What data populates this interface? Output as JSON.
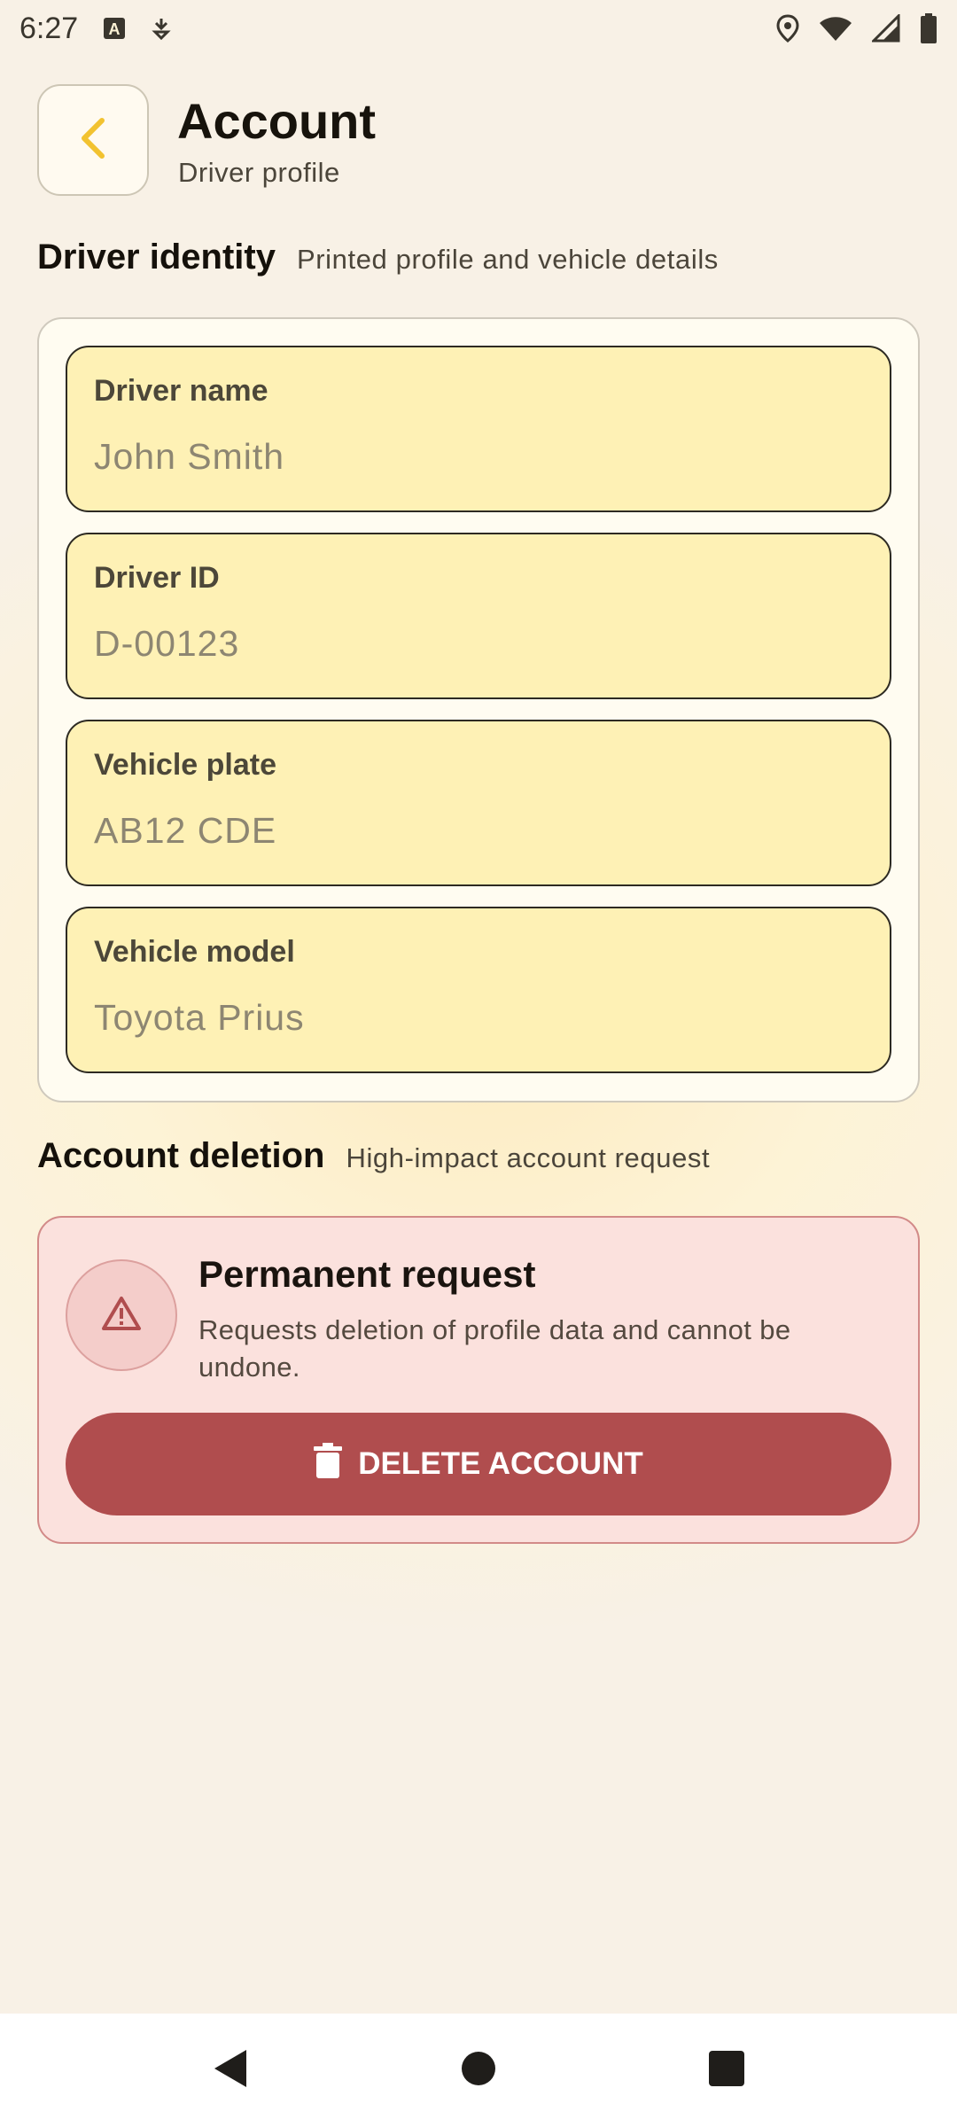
{
  "status_bar": {
    "time": "6:27",
    "icons_left": [
      "keyboard-a-icon",
      "download-arrow-icon"
    ],
    "icons_right": [
      "location-icon",
      "wifi-icon",
      "signal-icon",
      "battery-icon"
    ]
  },
  "header": {
    "back_icon": "chevron-left-icon",
    "title": "Account",
    "subtitle": "Driver profile"
  },
  "identity": {
    "title": "Driver identity",
    "hint": "Printed profile and vehicle details",
    "fields": [
      {
        "label": "Driver name",
        "value": "John Smith"
      },
      {
        "label": "Driver ID",
        "value": "D-00123"
      },
      {
        "label": "Vehicle plate",
        "value": "AB12 CDE"
      },
      {
        "label": "Vehicle model",
        "value": "Toyota Prius"
      }
    ]
  },
  "deletion": {
    "title": "Account deletion",
    "hint": "High-impact account request",
    "card_title": "Permanent request",
    "card_description": "Requests deletion of profile data and cannot be undone.",
    "button_label": "DELETE ACCOUNT",
    "warning_icon": "warning-triangle-icon",
    "button_icon": "trash-icon"
  },
  "colors": {
    "accent": "#f2c230",
    "field_bg": "#fef1b5",
    "danger": "#b04d4e",
    "danger_bg": "#fbe1dd"
  },
  "nav_bar": [
    "back-triangle-icon",
    "home-circle-icon",
    "recents-square-icon"
  ]
}
